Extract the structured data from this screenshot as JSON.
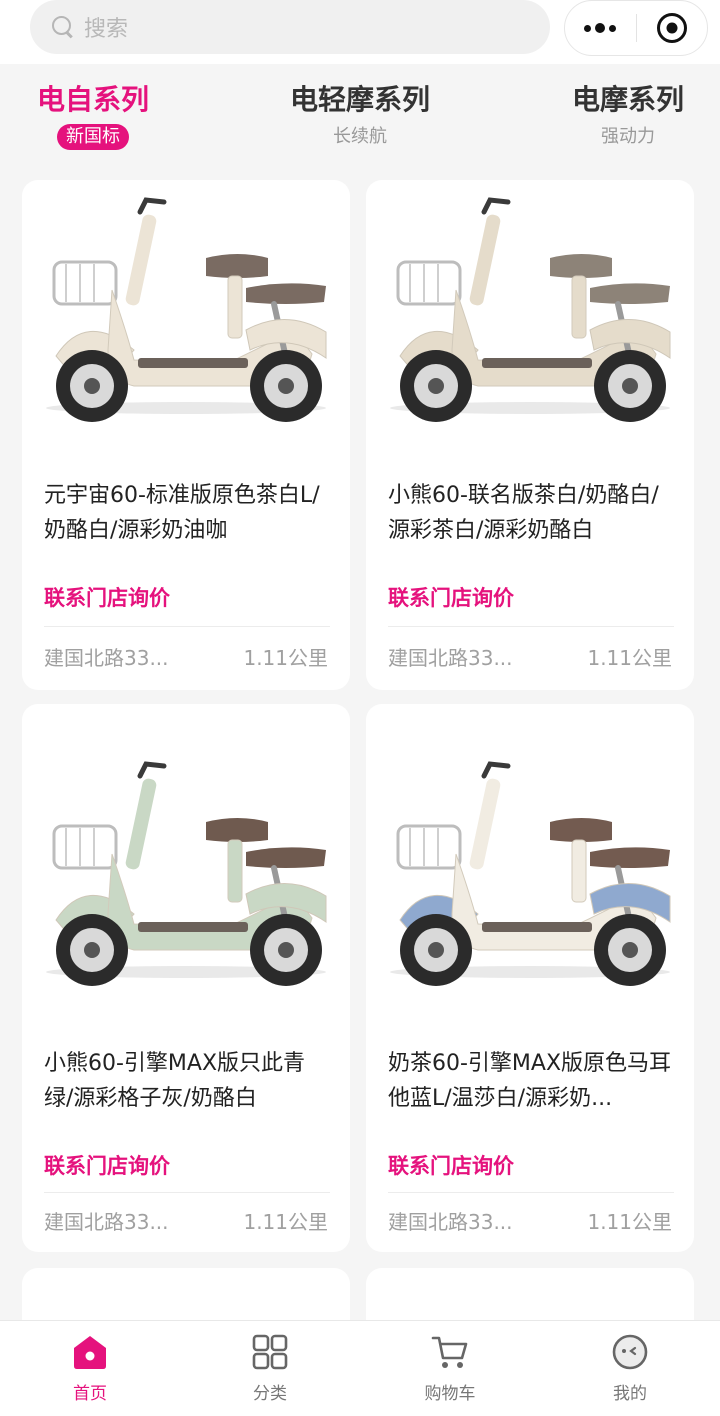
{
  "search": {
    "placeholder": "搜索"
  },
  "tabs": [
    {
      "title": "电自系列",
      "sub": "新国标"
    },
    {
      "title": "电轻摩系列",
      "sub": "长续航"
    },
    {
      "title": "电摩系列",
      "sub": "强动力"
    }
  ],
  "products": [
    {
      "title": "元宇宙60-标准版原色茶白L/奶酪白/源彩奶油咖",
      "price": "联系门店询价",
      "store": "建国北路33...",
      "distance": "1.11公里",
      "colors": {
        "body": "#ece4d6",
        "seat": "#7a6b62",
        "fender": "#ece4d6"
      }
    },
    {
      "title": "小熊60-联名版茶白/奶酪白/源彩茶白/源彩奶酪白",
      "price": "联系门店询价",
      "store": "建国北路33...",
      "distance": "1.11公里",
      "colors": {
        "body": "#e5dccb",
        "seat": "#8d8378",
        "fender": "#e5dccb"
      }
    },
    {
      "title": "小熊60-引擎MAX版只此青绿/源彩格子灰/奶酪白",
      "price": "联系门店询价",
      "store": "建国北路33...",
      "distance": "1.11公里",
      "colors": {
        "body": "#c9d8c5",
        "seat": "#6f5a4f",
        "fender": "#c9d8c5"
      }
    },
    {
      "title": "奶茶60-引擎MAX版原色马耳他蓝L/温莎白/源彩奶...",
      "price": "联系门店询价",
      "store": "建国北路33...",
      "distance": "1.11公里",
      "colors": {
        "body": "#f1ece2",
        "seat": "#735b50",
        "fender": "#8fa9cf"
      }
    }
  ],
  "nav": [
    {
      "label": "首页",
      "icon": "home-icon"
    },
    {
      "label": "分类",
      "icon": "grid-icon"
    },
    {
      "label": "购物车",
      "icon": "cart-icon"
    },
    {
      "label": "我的",
      "icon": "profile-icon"
    }
  ],
  "accent": "#e5127d"
}
